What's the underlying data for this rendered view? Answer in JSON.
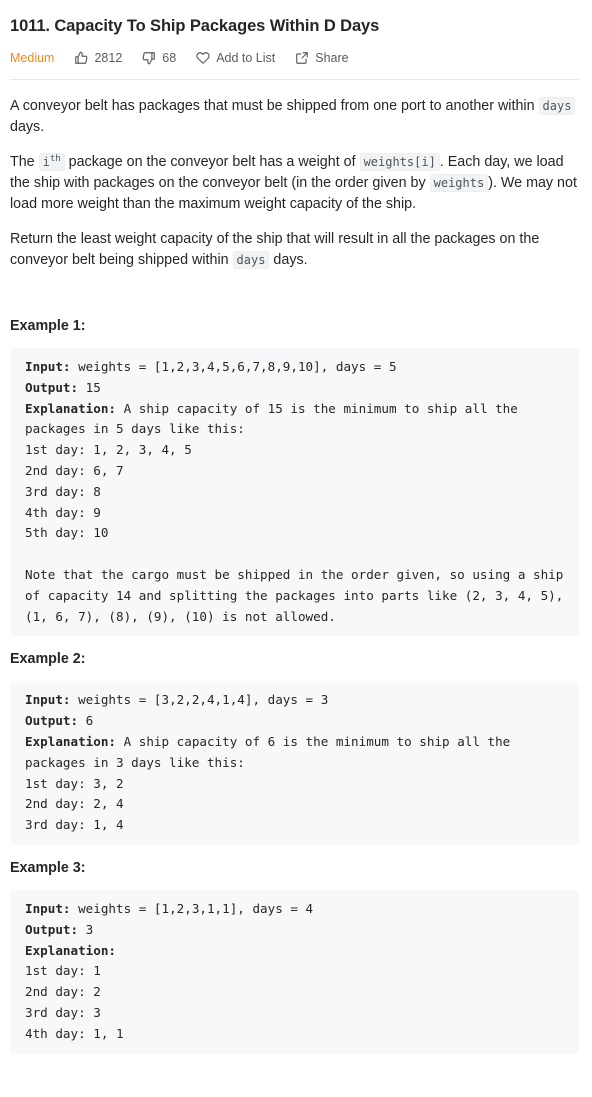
{
  "problem": {
    "title": "1011. Capacity To Ship Packages Within D Days",
    "difficulty": "Medium",
    "likes": "2812",
    "dislikes": "68",
    "add_to_list": "Add to List",
    "share": "Share"
  },
  "description": {
    "p1_a": "A conveyor belt has packages that must be shipped from one port to another within ",
    "p1_code": "days",
    "p1_b": " days.",
    "p2_a": "The ",
    "p2_code_i": "i",
    "p2_sup": "th",
    "p2_b": " package on the conveyor belt has a weight of ",
    "p2_code_w": "weights[i]",
    "p2_c": ". Each day, we load the ship with packages on the conveyor belt (in the order given by ",
    "p2_code_w2": "weights",
    "p2_d": "). We may not load more weight than the maximum weight capacity of the ship.",
    "p3_a": "Return the least weight capacity of the ship that will result in all the packages on the conveyor belt being shipped within ",
    "p3_code": "days",
    "p3_b": " days."
  },
  "examples": [
    {
      "title": "Example 1:",
      "input_label": "Input:",
      "input": " weights = [1,2,3,4,5,6,7,8,9,10], days = 5",
      "output_label": "Output:",
      "output": " 15",
      "explanation_label": "Explanation:",
      "explanation": " A ship capacity of 15 is the minimum to ship all the packages in 5 days like this:",
      "lines": [
        "1st day: 1, 2, 3, 4, 5",
        "2nd day: 6, 7",
        "3rd day: 8",
        "4th day: 9",
        "5th day: 10"
      ],
      "note": "Note that the cargo must be shipped in the order given, so using a ship of capacity 14 and splitting the packages into parts like (2, 3, 4, 5), (1, 6, 7), (8), (9), (10) is not allowed."
    },
    {
      "title": "Example 2:",
      "input_label": "Input:",
      "input": " weights = [3,2,2,4,1,4], days = 3",
      "output_label": "Output:",
      "output": " 6",
      "explanation_label": "Explanation:",
      "explanation": " A ship capacity of 6 is the minimum to ship all the packages in 3 days like this:",
      "lines": [
        "1st day: 3, 2",
        "2nd day: 2, 4",
        "3rd day: 1, 4"
      ]
    },
    {
      "title": "Example 3:",
      "input_label": "Input:",
      "input": " weights = [1,2,3,1,1], days = 4",
      "output_label": "Output:",
      "output": " 3",
      "explanation_label": "Explanation:",
      "explanation": "",
      "lines": [
        "1st day: 1",
        "2nd day: 2",
        "3rd day: 3",
        "4th day: 1, 1"
      ]
    }
  ],
  "icons": {
    "like": "thumbs-up-icon",
    "dislike": "thumbs-down-icon",
    "add_to_list": "heart-icon",
    "share": "share-icon"
  },
  "colors": {
    "difficulty": "#ef8a17",
    "code_bg": "#f7f8f9"
  }
}
